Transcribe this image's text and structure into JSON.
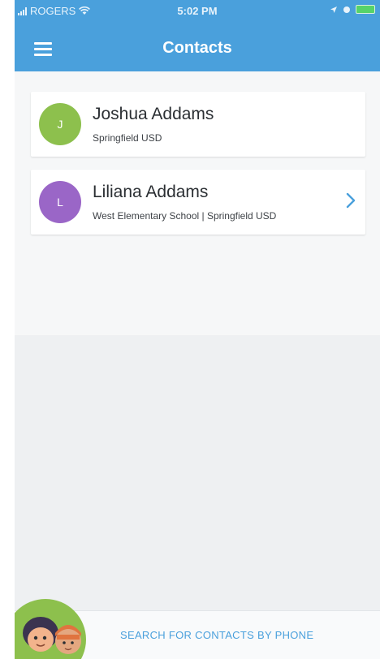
{
  "status_bar": {
    "carrier": "ROGERS",
    "time": "5:02 PM"
  },
  "header": {
    "title": "Contacts",
    "color": "#4aa0dc"
  },
  "contacts": [
    {
      "initial": "J",
      "name": "Joshua Addams",
      "organization": "Springfield USD",
      "avatar_color": "#8dc04d",
      "has_chevron": false
    },
    {
      "initial": "L",
      "name": "Liliana Addams",
      "organization": "West Elementary School | Springfield USD",
      "avatar_color": "#9a66c7",
      "has_chevron": true
    }
  ],
  "footer": {
    "search_label": "SEARCH FOR CONTACTS BY PHONE"
  },
  "icons": {
    "menu": "hamburger-menu-icon",
    "wifi": "wifi-icon",
    "location": "location-arrow-icon",
    "alarm": "alarm-icon",
    "battery": "battery-icon",
    "chevron": "chevron-right-icon"
  }
}
